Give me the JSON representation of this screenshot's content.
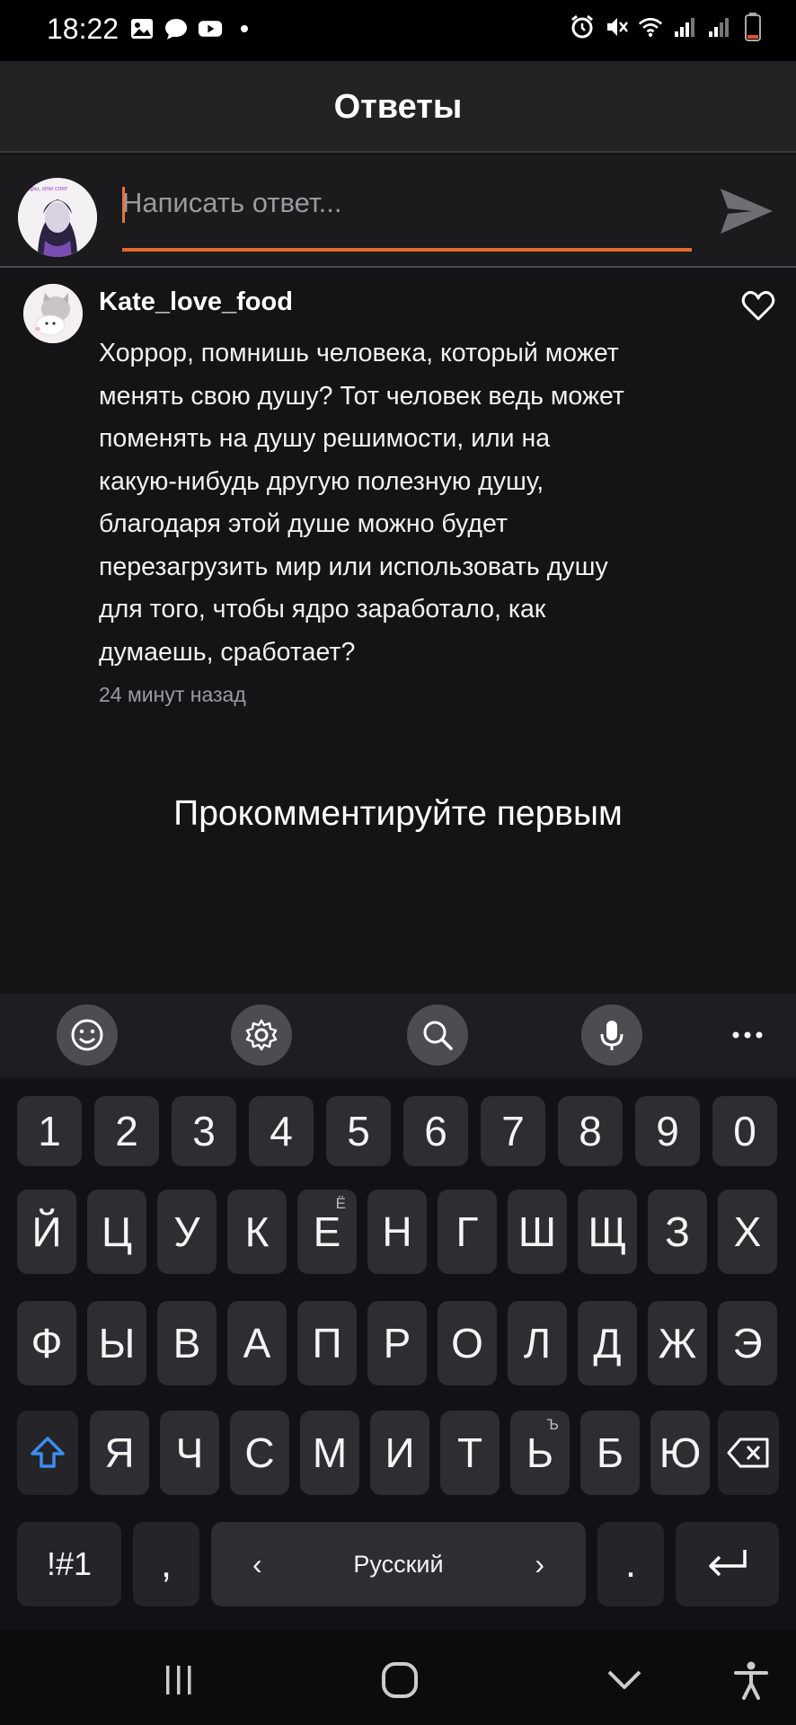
{
  "status_bar": {
    "time": "18:22",
    "left_icons": [
      "gallery-icon",
      "message-icon",
      "youtube-icon",
      "dot-icon"
    ],
    "right_icons": [
      "alarm-icon",
      "mute-icon",
      "wifi-icon",
      "signal-icon",
      "signal-icon",
      "battery-icon"
    ],
    "battery_level": 0.15
  },
  "header": {
    "title": "Ответы"
  },
  "composer": {
    "placeholder": "Написать ответ...",
    "value": "",
    "avatar_caption": "Пуфы, или спят",
    "send_icon": "send-icon"
  },
  "comment": {
    "author": "Kate_love_food",
    "lines": [
      "Хоррор, помнишь человека, который может",
      "менять свою душу? Тот человек ведь может",
      "поменять на душу решимости, или на",
      "какую-нибудь другую полезную душу,",
      "благодаря этой душе можно будет",
      "перезагрузить мир или использовать душу",
      "для того, чтобы ядро заработало, как",
      "думаешь, сработает?"
    ],
    "time": "24 минут назад",
    "like_icon": "heart-icon"
  },
  "empty_message": "Прокомментируйте первым",
  "keyboard": {
    "toolbar": [
      "emoji-icon",
      "settings-icon",
      "search-icon",
      "microphone-icon",
      "more-icon"
    ],
    "number_row": [
      "1",
      "2",
      "3",
      "4",
      "5",
      "6",
      "7",
      "8",
      "9",
      "0"
    ],
    "row1": [
      "Й",
      "Ц",
      "У",
      "К",
      "Е",
      "Н",
      "Г",
      "Ш",
      "Щ",
      "З",
      "Х"
    ],
    "row1_hints": {
      "Е": "Ё"
    },
    "row2": [
      "Ф",
      "Ы",
      "В",
      "А",
      "П",
      "Р",
      "О",
      "Л",
      "Д",
      "Ж",
      "Э"
    ],
    "row3": [
      "Я",
      "Ч",
      "С",
      "М",
      "И",
      "Т",
      "Ь",
      "Б",
      "Ю"
    ],
    "row3_hints": {
      "Ь": "Ъ"
    },
    "symbols_label": "!#1",
    "comma_label": ",",
    "space_label": "Русский",
    "left_arrow": "‹",
    "right_arrow": "›",
    "period_label": ".",
    "accent_color": "#3a8ef0"
  },
  "nav_bar": [
    "recents-icon",
    "home-icon",
    "back-icon",
    "accessibility-icon"
  ]
}
